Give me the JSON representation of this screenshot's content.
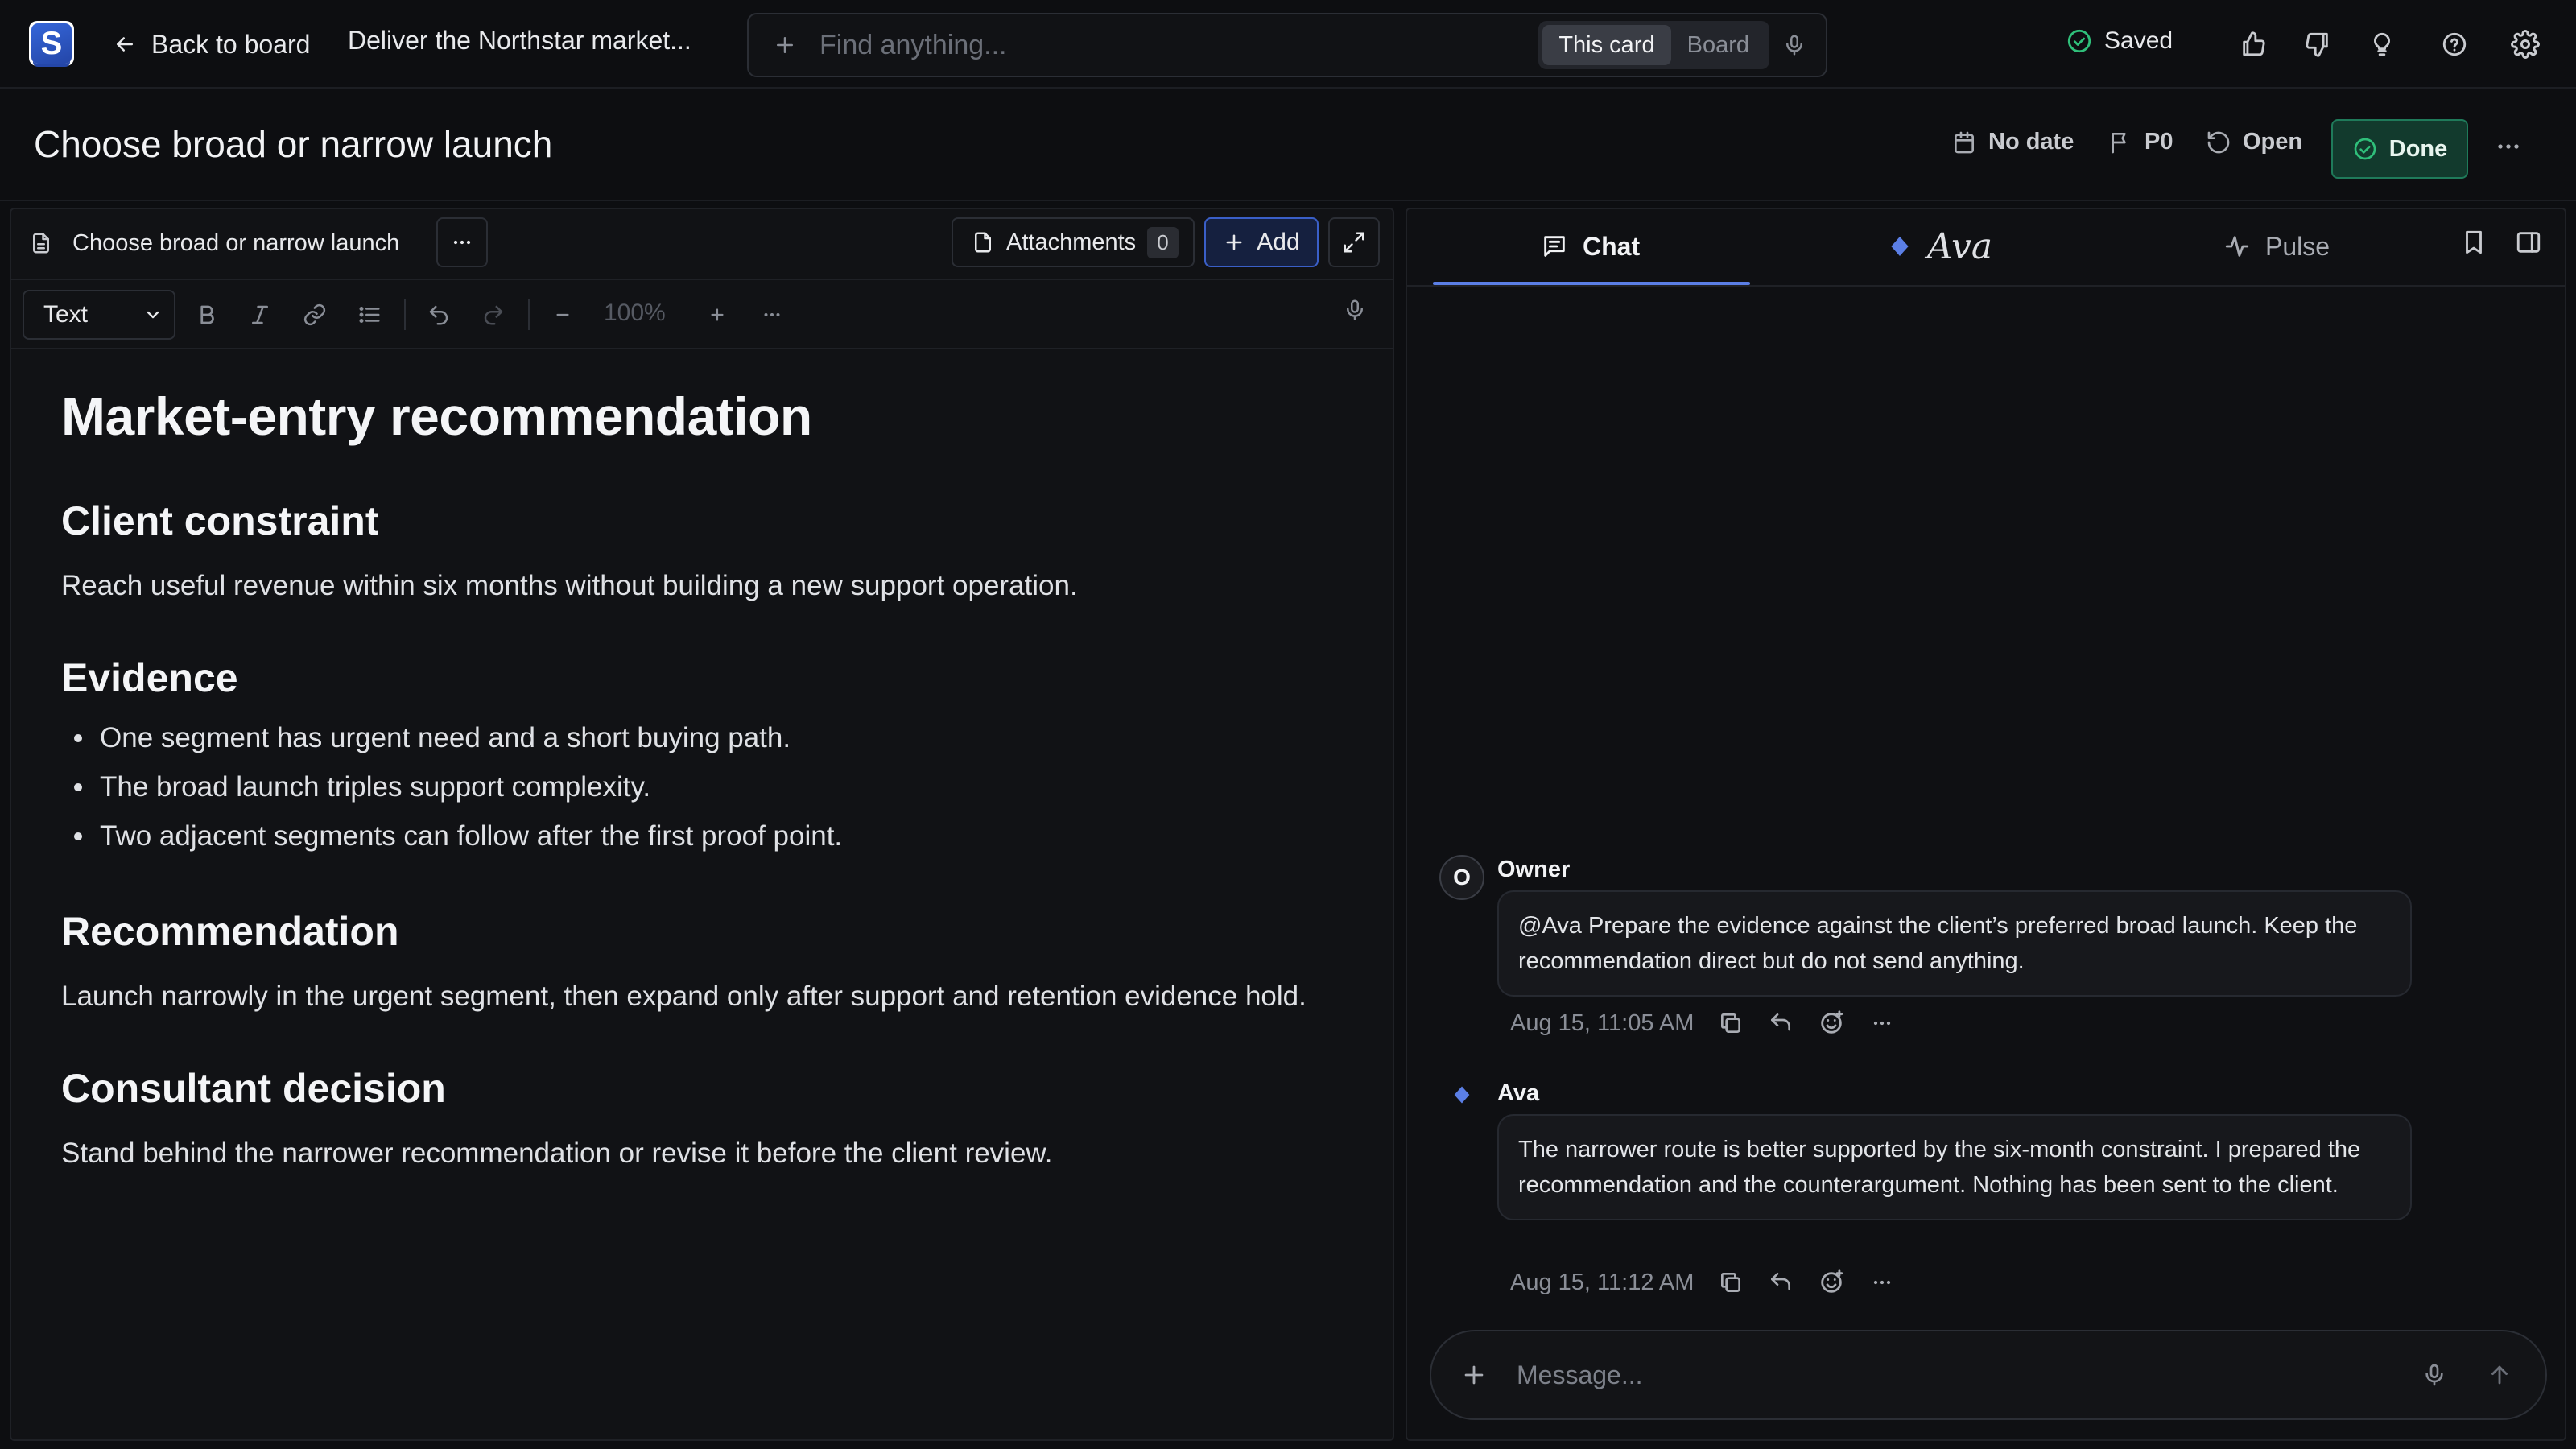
{
  "app": {
    "logo_letter": "S",
    "accent_color": "#5b7fe6",
    "success_color": "#2fbf7a"
  },
  "topbar": {
    "back_label": "Back to board",
    "card_breadcrumb": "Deliver the Northstar market...",
    "search_placeholder": "Find anything...",
    "scope_options": [
      "This card",
      "Board"
    ],
    "scope_selected": "This card",
    "saved_label": "Saved",
    "icons": [
      "thumbs-up-icon",
      "thumbs-down-icon",
      "lightbulb-icon",
      "help-icon",
      "settings-icon"
    ]
  },
  "card": {
    "title": "Choose broad or narrow launch",
    "date_label": "No date",
    "priority_label": "P0",
    "status_label": "Open",
    "done_label": "Done"
  },
  "editor": {
    "doc_tab_label": "Choose broad or narrow launch",
    "attachments_label": "Attachments",
    "attachments_count": "0",
    "add_label": "Add",
    "format_selected": "Text",
    "zoom_level": "100%",
    "document": {
      "title": "Market-entry recommendation",
      "sections": [
        {
          "heading": "Client constraint",
          "paragraph": "Reach useful revenue within six months without building a new support operation."
        },
        {
          "heading": "Evidence",
          "bullets": [
            "One segment has urgent need and a short buying path.",
            "The broad launch triples support complexity.",
            "Two adjacent segments can follow after the first proof point."
          ]
        },
        {
          "heading": "Recommendation",
          "paragraph": "Launch narrowly in the urgent segment, then expand only after support and retention evidence hold."
        },
        {
          "heading": "Consultant decision",
          "paragraph": "Stand behind the narrower recommendation or revise it before the client review."
        }
      ]
    }
  },
  "chat": {
    "tabs": [
      {
        "label": "Chat",
        "icon": "chat-icon",
        "active": true
      },
      {
        "label": "Ava",
        "icon": "ava-diamond-icon",
        "active": false
      },
      {
        "label": "Pulse",
        "icon": "pulse-icon",
        "active": false
      }
    ],
    "messages": [
      {
        "author": "Owner",
        "avatar_letter": "O",
        "text": "@Ava Prepare the evidence against the client’s preferred broad launch. Keep the recommendation direct but do not send anything.",
        "timestamp": "Aug 15, 11:05 AM"
      },
      {
        "author": "Ava",
        "text": "The narrower route is better supported by the six-month constraint. I prepared the recommendation and the counterargument. Nothing has been sent to the client.",
        "timestamp": "Aug 15, 11:12 AM"
      }
    ],
    "composer_placeholder": "Message..."
  }
}
